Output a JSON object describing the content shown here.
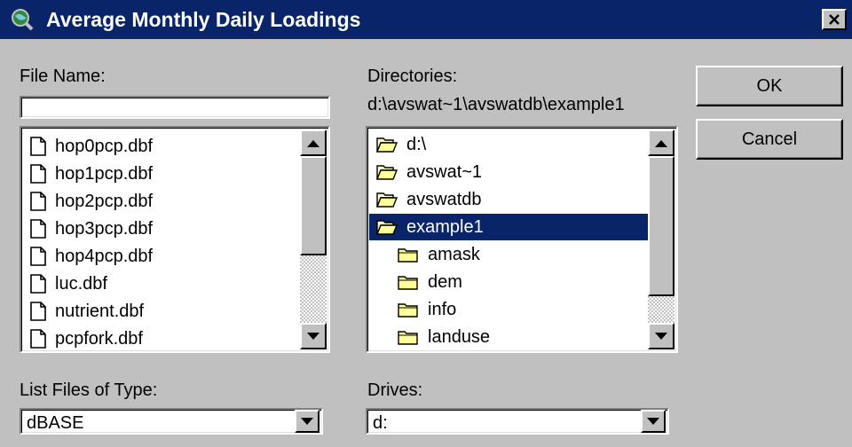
{
  "window": {
    "title": "Average Monthly Daily Loadings",
    "close_icon": "close-icon"
  },
  "file_name": {
    "label": "File Name:",
    "value": ""
  },
  "files": {
    "items": [
      "hop0pcp.dbf",
      "hop1pcp.dbf",
      "hop2pcp.dbf",
      "hop3pcp.dbf",
      "hop4pcp.dbf",
      "luc.dbf",
      "nutrient.dbf",
      "pcpfork.dbf"
    ]
  },
  "directories": {
    "label": "Directories:",
    "path": "d:\\avswat~1\\avswatdb\\example1",
    "items": [
      "d:\\",
      "avswat~1",
      "avswatdb",
      "example1",
      "amask",
      "dem",
      "info",
      "landuse"
    ],
    "selected": "example1"
  },
  "file_type": {
    "label": "List Files of Type:",
    "value": "dBASE"
  },
  "drives": {
    "label": "Drives:",
    "value": "d:"
  },
  "buttons": {
    "ok": "OK",
    "cancel": "Cancel"
  },
  "colors": {
    "titlebar": "#0a246a",
    "face": "#c0c0c0",
    "selection": "#0a246a"
  }
}
